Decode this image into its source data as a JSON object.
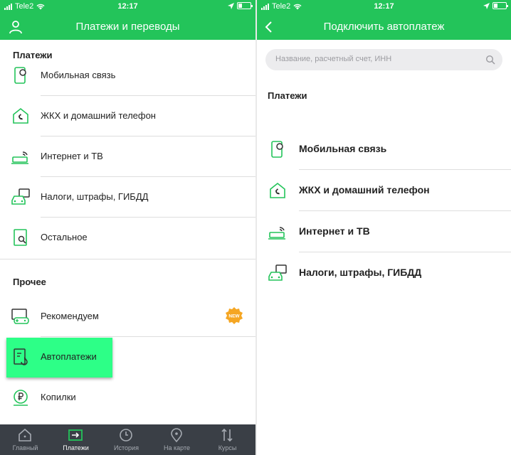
{
  "status_bar": {
    "carrier": "Tele2",
    "time": "12:17"
  },
  "colors": {
    "brand": "#23c45a",
    "highlight": "#2dff87",
    "tabbar": "#3a3f46",
    "badge": "#f5a623"
  },
  "left_screen": {
    "title": "Платежи и переводы",
    "profile_icon": "user-icon",
    "payments_section": "Платежи",
    "payments": [
      {
        "label": "Мобильная связь",
        "icon": "phone-icon"
      },
      {
        "label": "ЖКХ и домашний телефон",
        "icon": "house-icon"
      },
      {
        "label": "Интернет и ТВ",
        "icon": "router-icon"
      },
      {
        "label": "Налоги, штрафы, ГИБДД",
        "icon": "car-icon"
      },
      {
        "label": "Остальное",
        "icon": "search-doc-icon"
      }
    ],
    "other_section": "Прочее",
    "other": [
      {
        "label": "Рекомендуем",
        "icon": "gamepad-icon",
        "badge": "NEW"
      },
      {
        "label": "Автоплатежи",
        "icon": "autopay-icon"
      },
      {
        "label": "Копилки",
        "icon": "ruble-icon"
      }
    ],
    "tabs": [
      {
        "label": "Главный",
        "icon": "home-icon"
      },
      {
        "label": "Платежи",
        "icon": "payments-icon",
        "active": true
      },
      {
        "label": "История",
        "icon": "clock-icon"
      },
      {
        "label": "На карте",
        "icon": "map-pin-icon"
      },
      {
        "label": "Курсы",
        "icon": "arrows-icon"
      }
    ]
  },
  "right_screen": {
    "title": "Подключить автоплатеж",
    "search_placeholder": "Название, расчетный счет, ИНН",
    "payments_section": "Платежи",
    "payments": [
      {
        "label": "Мобильная связь",
        "icon": "phone-icon"
      },
      {
        "label": "ЖКХ и домашний телефон",
        "icon": "house-icon"
      },
      {
        "label": "Интернет и ТВ",
        "icon": "router-icon"
      },
      {
        "label": "Налоги, штрафы, ГИБДД",
        "icon": "car-icon"
      }
    ]
  }
}
